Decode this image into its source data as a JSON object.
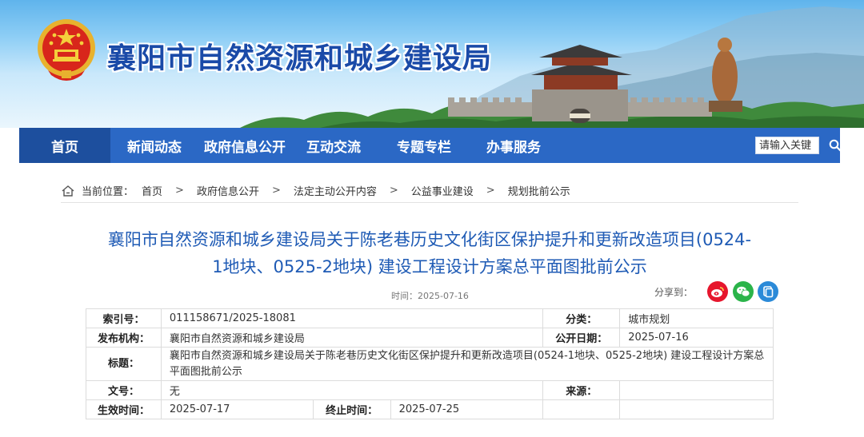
{
  "site": {
    "title": "襄阳市自然资源和城乡建设局",
    "emblem_icon": "national-emblem-icon",
    "gate_plaque": "襄阳门"
  },
  "nav": {
    "items": [
      {
        "label": "首页",
        "active": true
      },
      {
        "label": "新闻动态"
      },
      {
        "label": "政府信息公开"
      },
      {
        "label": "互动交流"
      },
      {
        "label": "专题专栏"
      },
      {
        "label": "办事服务"
      }
    ],
    "search_placeholder": "请输入关键",
    "search_icon": "magnifier-icon"
  },
  "breadcrumb": {
    "label": "当前位置：",
    "items": [
      "首页",
      "政府信息公开",
      "法定主动公开内容",
      "公益事业建设",
      "规划批前公示"
    ],
    "separator": ">"
  },
  "article": {
    "title_line1": "襄阳市自然资源和城乡建设局关于陈老巷历史文化街区保护提升和更新改造项目(0524-",
    "title_line2": "1地块、0525-2地块) 建设工程设计方案总平面图批前公示",
    "time_label": "时间：",
    "time": "2025-07-16",
    "share_label": "分享到："
  },
  "info": {
    "index_label": "索引号：",
    "index_value": "011158671/2025-18081",
    "category_label": "分类：",
    "category_value": "城市规划",
    "publisher_label": "发布机构：",
    "publisher_value": "襄阳市自然资源和城乡建设局",
    "pubdate_label": "公开日期：",
    "pubdate_value": "2025-07-16",
    "subject_label": "标题：",
    "subject_value": "襄阳市自然资源和城乡建设局关于陈老巷历史文化街区保护提升和更新改造项目(0524-1地块、0525-2地块) 建设工程设计方案总平面图批前公示",
    "docno_label": "文号：",
    "docno_value": "无",
    "source_label": "来源：",
    "source_value": "",
    "effective_label": "生效时间：",
    "effective_value": "2025-07-17",
    "end_label": "终止时间：",
    "end_value": "2025-07-25"
  },
  "colors": {
    "nav_bg": "#2b68c5",
    "nav_active": "#1d4f9e",
    "title_blue": "#1f5bb5",
    "site_title": "#1a4aa8"
  }
}
